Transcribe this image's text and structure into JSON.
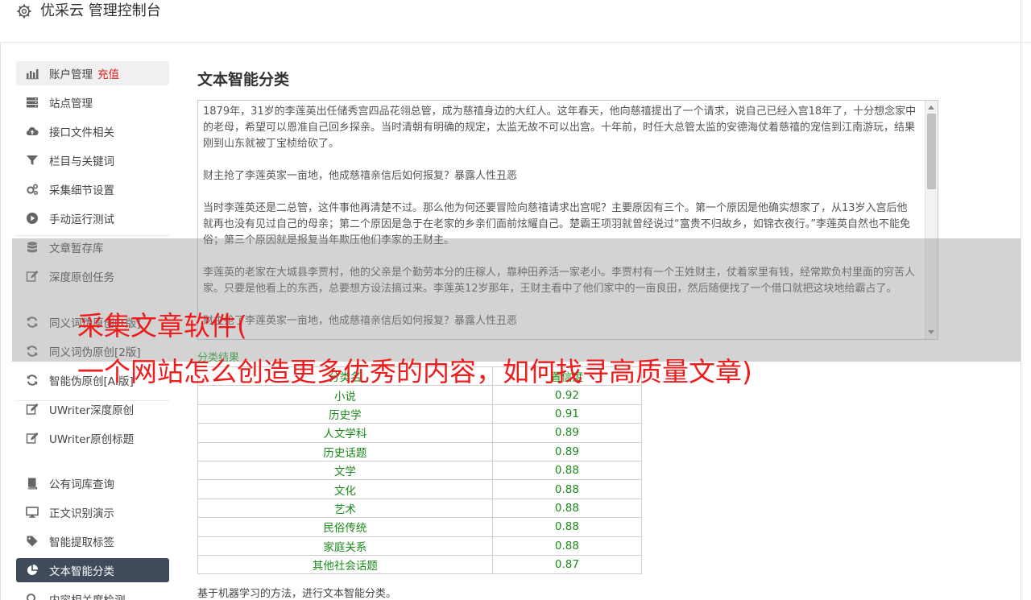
{
  "app": {
    "title": "优采云 管理控制台"
  },
  "sidebar": {
    "groups": [
      [
        {
          "label": "账户管理",
          "accent": "充值",
          "icon": "bar-chart-icon",
          "state": "current"
        },
        {
          "label": "站点管理",
          "icon": "server-icon"
        },
        {
          "label": "接口文件相关",
          "icon": "cloud-upload-icon"
        },
        {
          "label": "栏目与关键词",
          "icon": "filter-icon"
        },
        {
          "label": "采集细节设置",
          "icon": "cogs-icon"
        },
        {
          "label": "手动运行测试",
          "icon": "play-circle-icon"
        },
        {
          "label": "文章暂存库",
          "icon": "database-icon"
        },
        {
          "label": "深度原创任务",
          "icon": "edit-icon"
        }
      ],
      [
        {
          "label": "同义词伪原创[1版]",
          "icon": "refresh-icon"
        },
        {
          "label": "同义词伪原创[2版]",
          "icon": "refresh-icon"
        },
        {
          "label": "智能伪原创[AI版]",
          "icon": "refresh-icon"
        },
        {
          "label": "UWriter深度原创",
          "icon": "edit-icon"
        },
        {
          "label": "UWriter原创标题",
          "icon": "edit-icon"
        }
      ],
      [
        {
          "label": "公有词库查询",
          "icon": "book-icon"
        },
        {
          "label": "正文识别演示",
          "icon": "monitor-icon"
        },
        {
          "label": "智能提取标签",
          "icon": "tag-icon"
        },
        {
          "label": "文本智能分类",
          "icon": "pie-chart-icon",
          "state": "selected"
        },
        {
          "label": "内容相关度检测",
          "icon": "search-icon"
        }
      ]
    ]
  },
  "main": {
    "title": "文本智能分类",
    "paragraphs": [
      "1879年，31岁的李莲英出任储秀宫四品花翎总管，成为慈禧身边的大红人。这年春天，他向慈禧提出了一个请求，说自己已经入宫18年了，十分想念家中的老母，希望可以恩准自己回乡探亲。当时清朝有明确的规定，太监无故不可以出宫。十年前，时任大总管太监的安德海仗着慈禧的宠信到江南游玩，结果刚到山东就被丁宝桢给砍了。",
      "财主抢了李莲英家一亩地，他成慈禧亲信后如何报复？暴露人性丑恶",
      "当时李莲英还是二总管，这件事他再清楚不过。那么他为何还要冒险向慈禧请求出宫呢？主要原因有三个。第一个原因是他确实想家了，从13岁入宫后他就再也没有见过自己的母亲；第二个原因是急于在老家的乡亲们面前炫耀自己。楚霸王项羽就曾经说过“富贵不归故乡，如锦衣夜行。”李莲英自然也不能免俗；第三个原因就是报复当年欺压他们李家的王财主。",
      "李莲英的老家在大城县李贾村，他的父亲是个勤劳本分的庄稼人，靠种田养活一家老小。李贾村有一个王姓财主，仗着家里有钱，经常欺负村里面的穷苦人家。只要是他看上的东西，总要想方设法搞过来。李莲英12岁那年，王财主看中了他们家中的一亩良田，然后随便找了一个借口就把这块地给霸占了。",
      "财主抢了李莲英家一亩地，他成慈禧亲信后如何报复？暴露人性丑恶"
    ],
    "result_label": "分类结果",
    "table": {
      "headers": [
        "分类名",
        "置信度"
      ],
      "rows": [
        [
          "小说",
          "0.92"
        ],
        [
          "历史学",
          "0.91"
        ],
        [
          "人文学科",
          "0.89"
        ],
        [
          "历史话题",
          "0.89"
        ],
        [
          "文学",
          "0.88"
        ],
        [
          "文化",
          "0.88"
        ],
        [
          "艺术",
          "0.88"
        ],
        [
          "民俗传统",
          "0.88"
        ],
        [
          "家庭关系",
          "0.88"
        ],
        [
          "其他社会话题",
          "0.87"
        ]
      ]
    },
    "footnote": "基于机器学习的方法，进行文本智能分类。"
  },
  "overlay": {
    "line1": "采集文章软件(",
    "line2": "一个网站怎么创造更多优秀的内容，如何找寻高质量文章)"
  },
  "colors": {
    "selected_bg": "#3f4a5a",
    "accent_red": "#e02020",
    "table_green": "#1a8a1a",
    "overlay_red": "#ee1c1c"
  }
}
